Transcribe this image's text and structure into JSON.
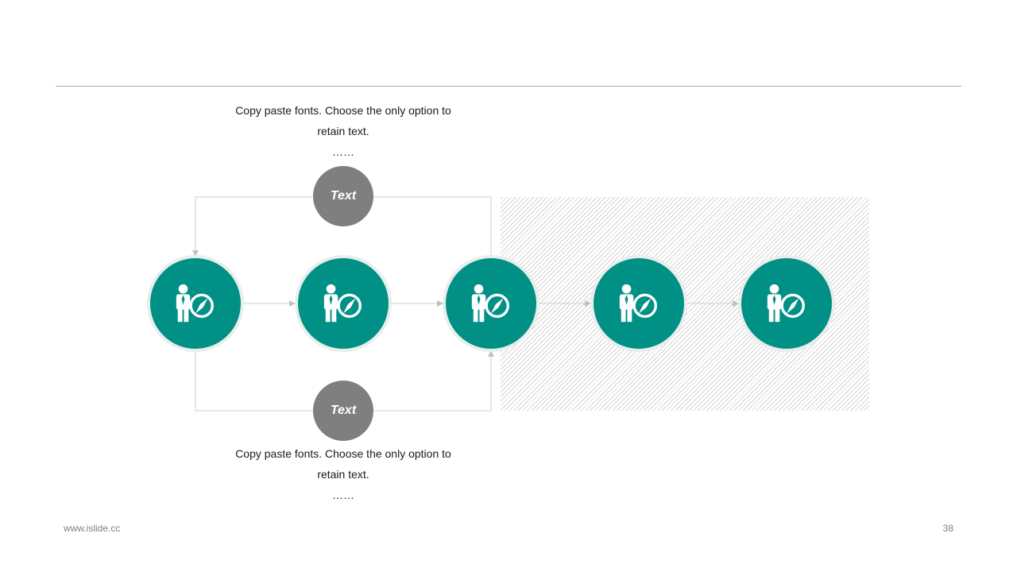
{
  "labels": {
    "top": "Text",
    "bottom": "Text"
  },
  "descriptions": {
    "top": {
      "line1": "Copy paste fonts. Choose the only option to",
      "line2": "retain text.",
      "line3": "……"
    },
    "bottom": {
      "line1": "Copy paste fonts. Choose the only option to",
      "line2": "retain text.",
      "line3": "……"
    }
  },
  "node_icon": "person-compass-icon",
  "colors": {
    "node": "#009085",
    "label_circle": "#7f7f7f",
    "connector": "#c8c8c8"
  },
  "footer": {
    "website": "www.islide.cc",
    "page_number": "38"
  }
}
